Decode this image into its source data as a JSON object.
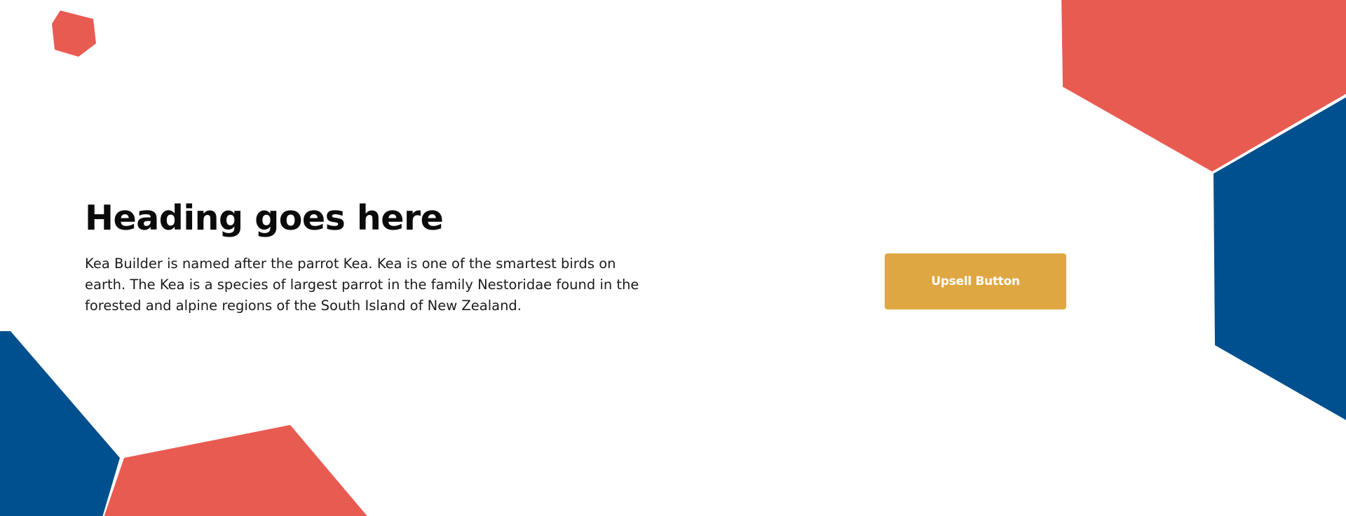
{
  "hero": {
    "heading": "Heading goes here",
    "body": "Kea Builder is named after the parrot Kea. Kea is one of the smartest birds on earth. The Kea is a species of largest parrot in the family Nestoridae found in the forested and alpine regions of the South Island of New Zealand.",
    "upsell_button_label": "Upsell Button"
  },
  "colors": {
    "coral": "#e85b51",
    "navy": "#004f8e",
    "button": "#dfa742",
    "background": "#ffffff",
    "heading_text": "#0b0b0b",
    "body_text": "#1b1b1b"
  },
  "decorations": [
    {
      "name": "small-coral-hexagon",
      "color": "coral"
    },
    {
      "name": "top-right-coral-hexagon",
      "color": "coral"
    },
    {
      "name": "right-navy-hexagon",
      "color": "navy"
    },
    {
      "name": "bottom-left-navy-hexagon",
      "color": "navy"
    },
    {
      "name": "bottom-coral-hexagon",
      "color": "coral"
    }
  ]
}
